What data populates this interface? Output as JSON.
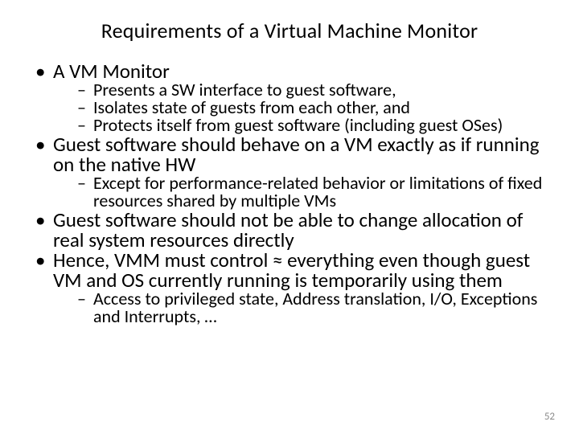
{
  "title": "Requirements of a Virtual Machine Monitor",
  "bullets": {
    "b1": "A VM Monitor",
    "b1s1": "Presents a SW interface to guest software,",
    "b1s2": "Isolates state of guests from each other, and",
    "b1s3": "Protects itself from guest software (including guest OSes)",
    "b2": "Guest software should behave on a VM exactly as if running on the native HW",
    "b2s1": "Except for performance-related behavior or limitations of fixed resources shared by multiple VMs",
    "b3": "Guest software should not be able to change allocation of real system resources directly",
    "b4": "Hence, VMM must control ≈ everything even though guest VM and OS currently running is temporarily using them",
    "b4s1": "Access to privileged state, Address translation, I/O, Exceptions and Interrupts, …"
  },
  "page_number": "52"
}
